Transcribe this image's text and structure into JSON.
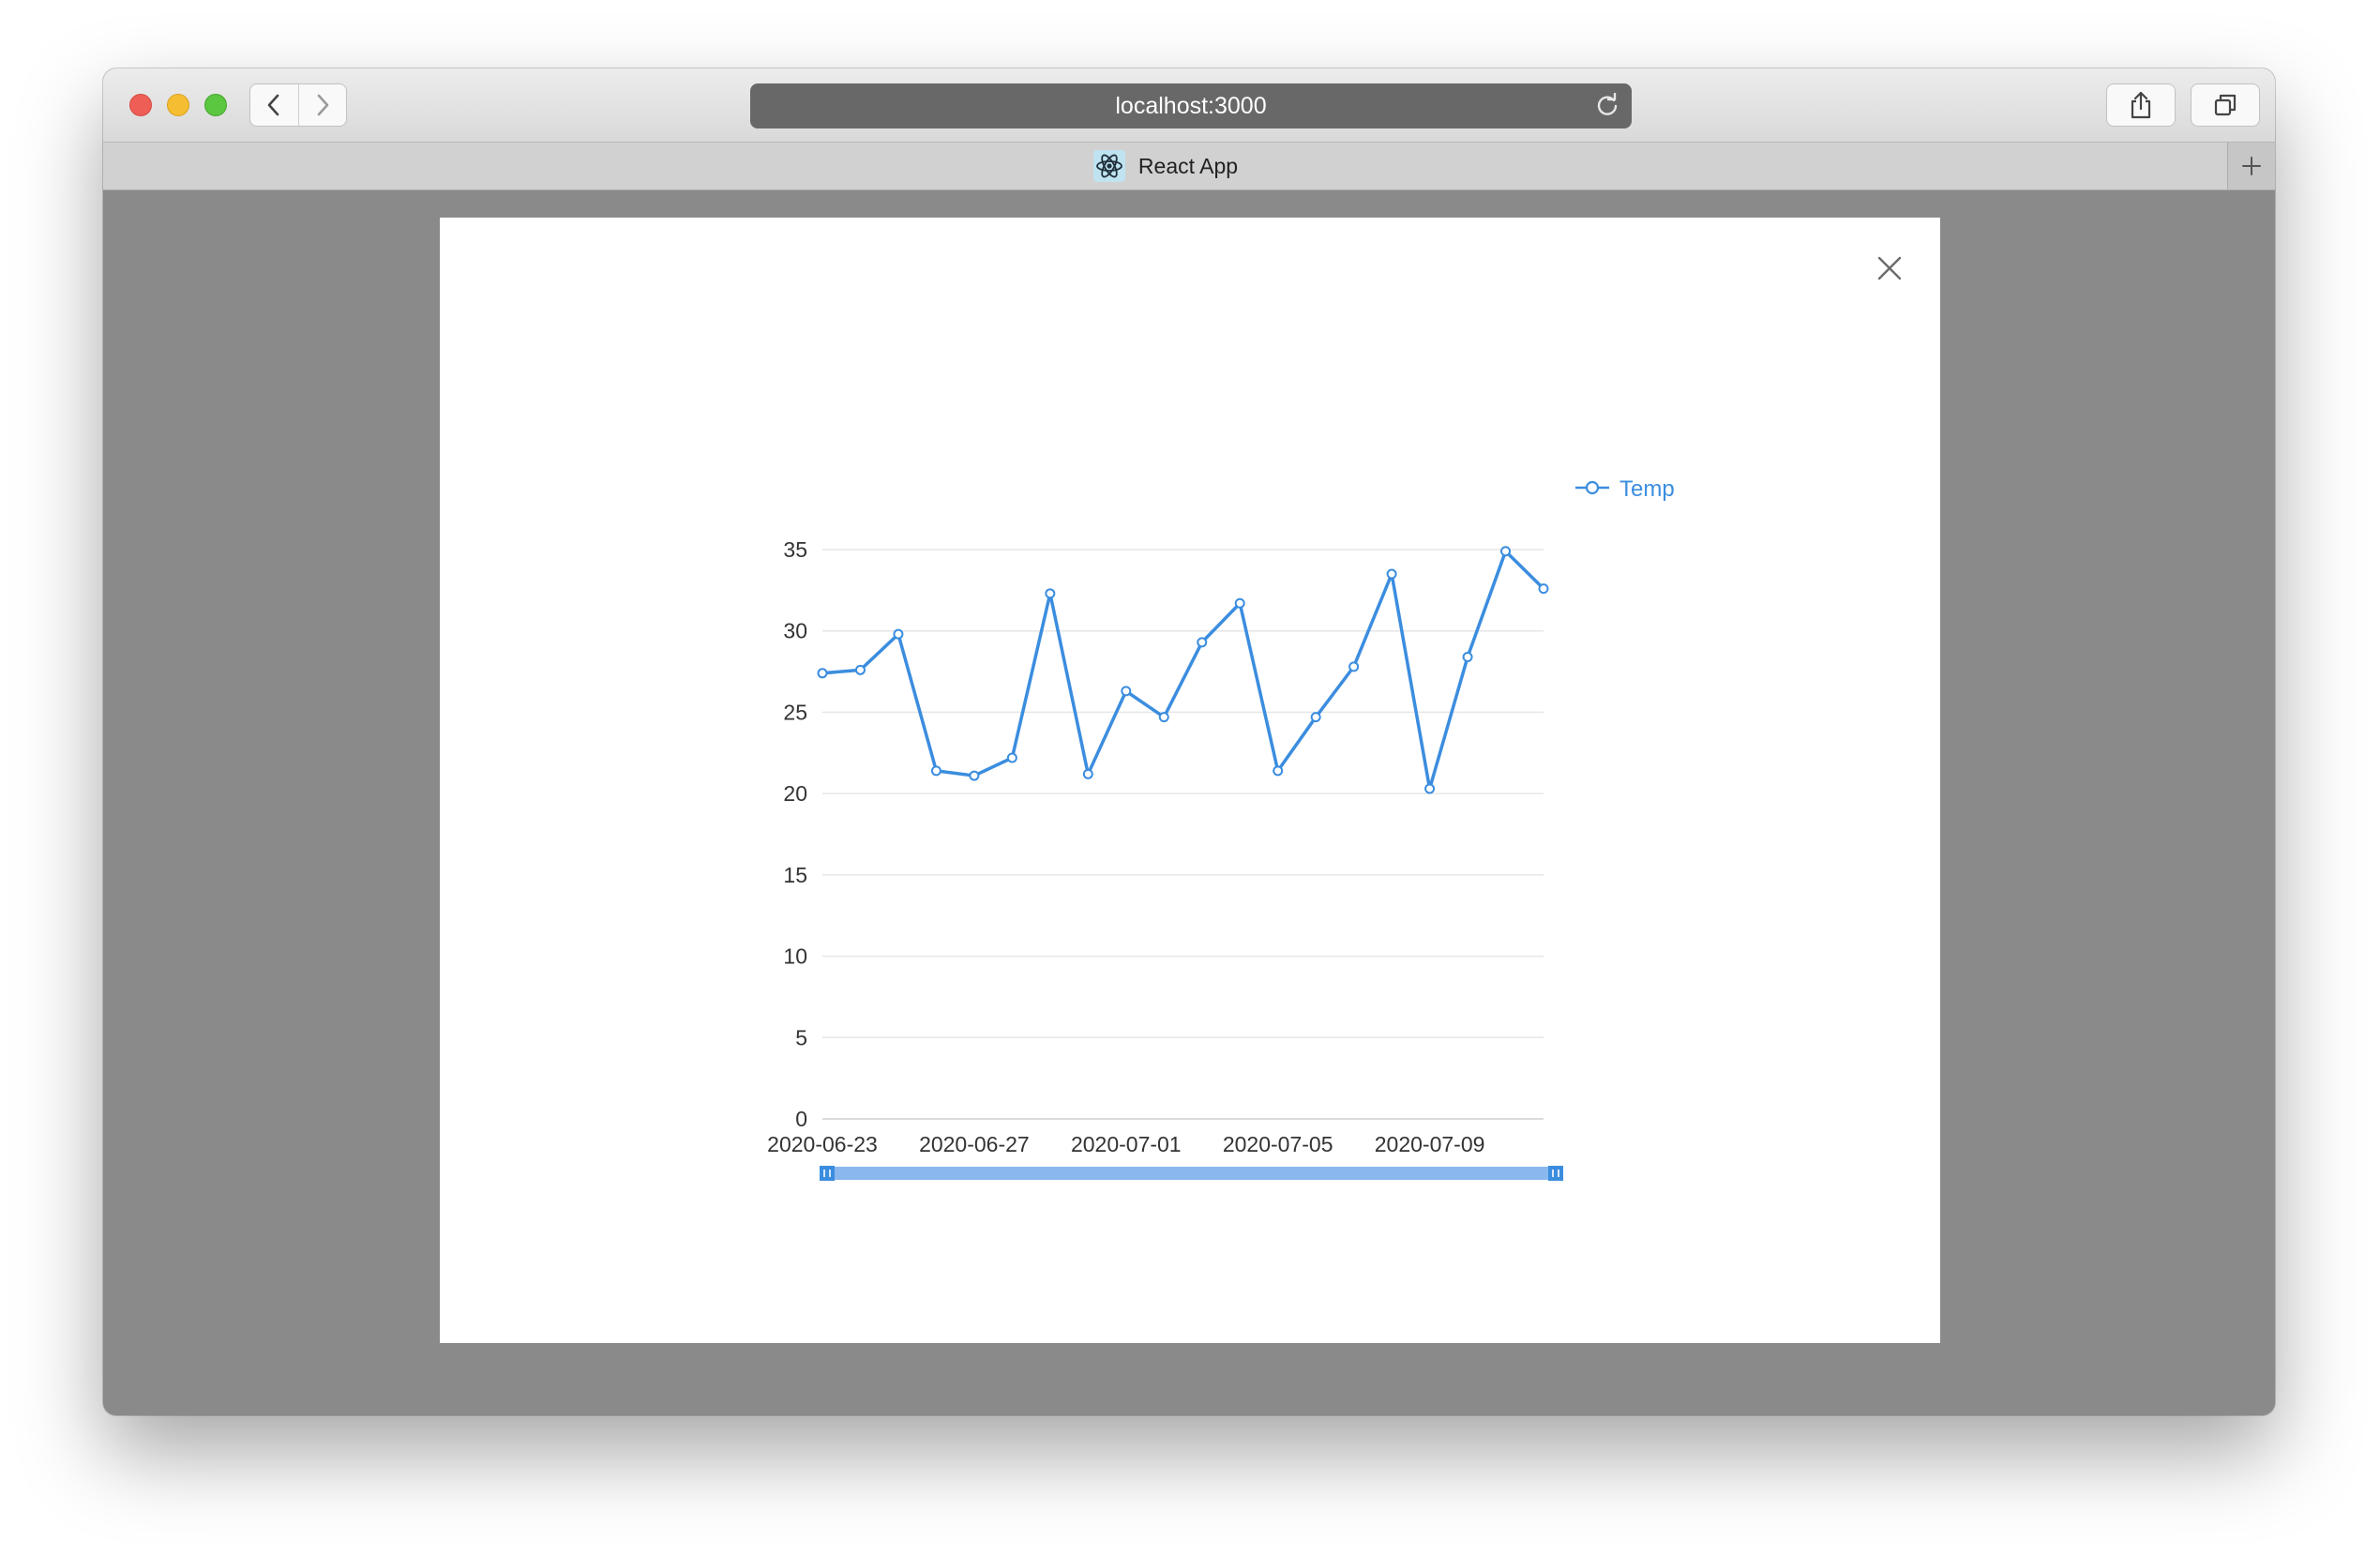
{
  "browser": {
    "url": "localhost:3000",
    "tab_title": "React App"
  },
  "icons": {
    "back": "chevron-left-icon",
    "forward": "chevron-right-icon",
    "reload": "reload-icon",
    "share": "share-icon",
    "tabs": "tabs-overview-icon",
    "new_tab": "plus-icon",
    "favicon": "react-logo-icon",
    "close": "close-icon"
  },
  "colors": {
    "series": "#3b8ddf",
    "slider": "#8ab8ee",
    "backdrop": "#8a8a8a"
  },
  "chart_data": {
    "type": "line",
    "legend_position": "top-right",
    "grid": true,
    "ylim": [
      0,
      35
    ],
    "y_ticks": [
      "0",
      "5",
      "10",
      "15",
      "20",
      "25",
      "30",
      "35"
    ],
    "x_tick_labels": [
      "2020-06-23",
      "2020-06-27",
      "2020-07-01",
      "2020-07-05",
      "2020-07-09"
    ],
    "x": [
      "2020-06-23",
      "2020-06-24",
      "2020-06-25",
      "2020-06-26",
      "2020-06-27",
      "2020-06-28",
      "2020-06-29",
      "2020-06-30",
      "2020-07-01",
      "2020-07-02",
      "2020-07-03",
      "2020-07-04",
      "2020-07-05",
      "2020-07-06",
      "2020-07-07",
      "2020-07-08",
      "2020-07-09",
      "2020-07-10",
      "2020-07-11",
      "2020-07-12"
    ],
    "series": [
      {
        "name": "Temp",
        "values": [
          27.4,
          27.6,
          29.8,
          21.4,
          21.1,
          22.2,
          32.3,
          21.2,
          26.3,
          24.7,
          29.3,
          31.7,
          21.4,
          24.7,
          27.8,
          33.5,
          20.3,
          28.4,
          34.9,
          32.6
        ]
      }
    ],
    "data_zoom": {
      "start": 0,
      "end": 100
    }
  }
}
